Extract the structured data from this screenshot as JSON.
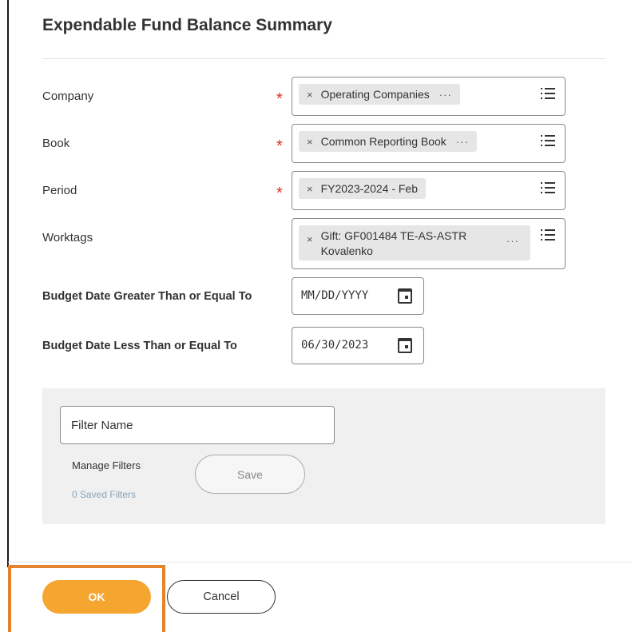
{
  "dialog": {
    "title": "Expendable Fund Balance Summary"
  },
  "fields": {
    "company": {
      "label": "Company",
      "value": "Operating Companies"
    },
    "book": {
      "label": "Book",
      "value": "Common Reporting Book"
    },
    "period": {
      "label": "Period",
      "value": "FY2023-2024 - Feb"
    },
    "worktags": {
      "label": "Worktags",
      "value_line1": "Gift: GF001484 TE-AS-ASTR",
      "value_line2": "Kovalenko"
    },
    "budget_date_gte": {
      "label": "Budget Date Greater Than or Equal To",
      "placeholder": "MM/DD/YYYY"
    },
    "budget_date_lte": {
      "label": "Budget Date Less Than or Equal To",
      "value": "06/30/2023"
    }
  },
  "required_mark": "*",
  "remove_glyph": "×",
  "more_glyph": "···",
  "filter": {
    "name_placeholder": "Filter Name",
    "manage_label": "Manage Filters",
    "saved_count": "0 Saved Filters",
    "save_label": "Save"
  },
  "footer": {
    "ok_label": "OK",
    "cancel_label": "Cancel"
  },
  "icons": {
    "list": "list-icon",
    "calendar": "calendar-icon",
    "remove": "close-icon",
    "more": "more-icon"
  },
  "colors": {
    "accent": "#f5a630",
    "required": "#de2e21",
    "highlight": "#e4822e"
  }
}
